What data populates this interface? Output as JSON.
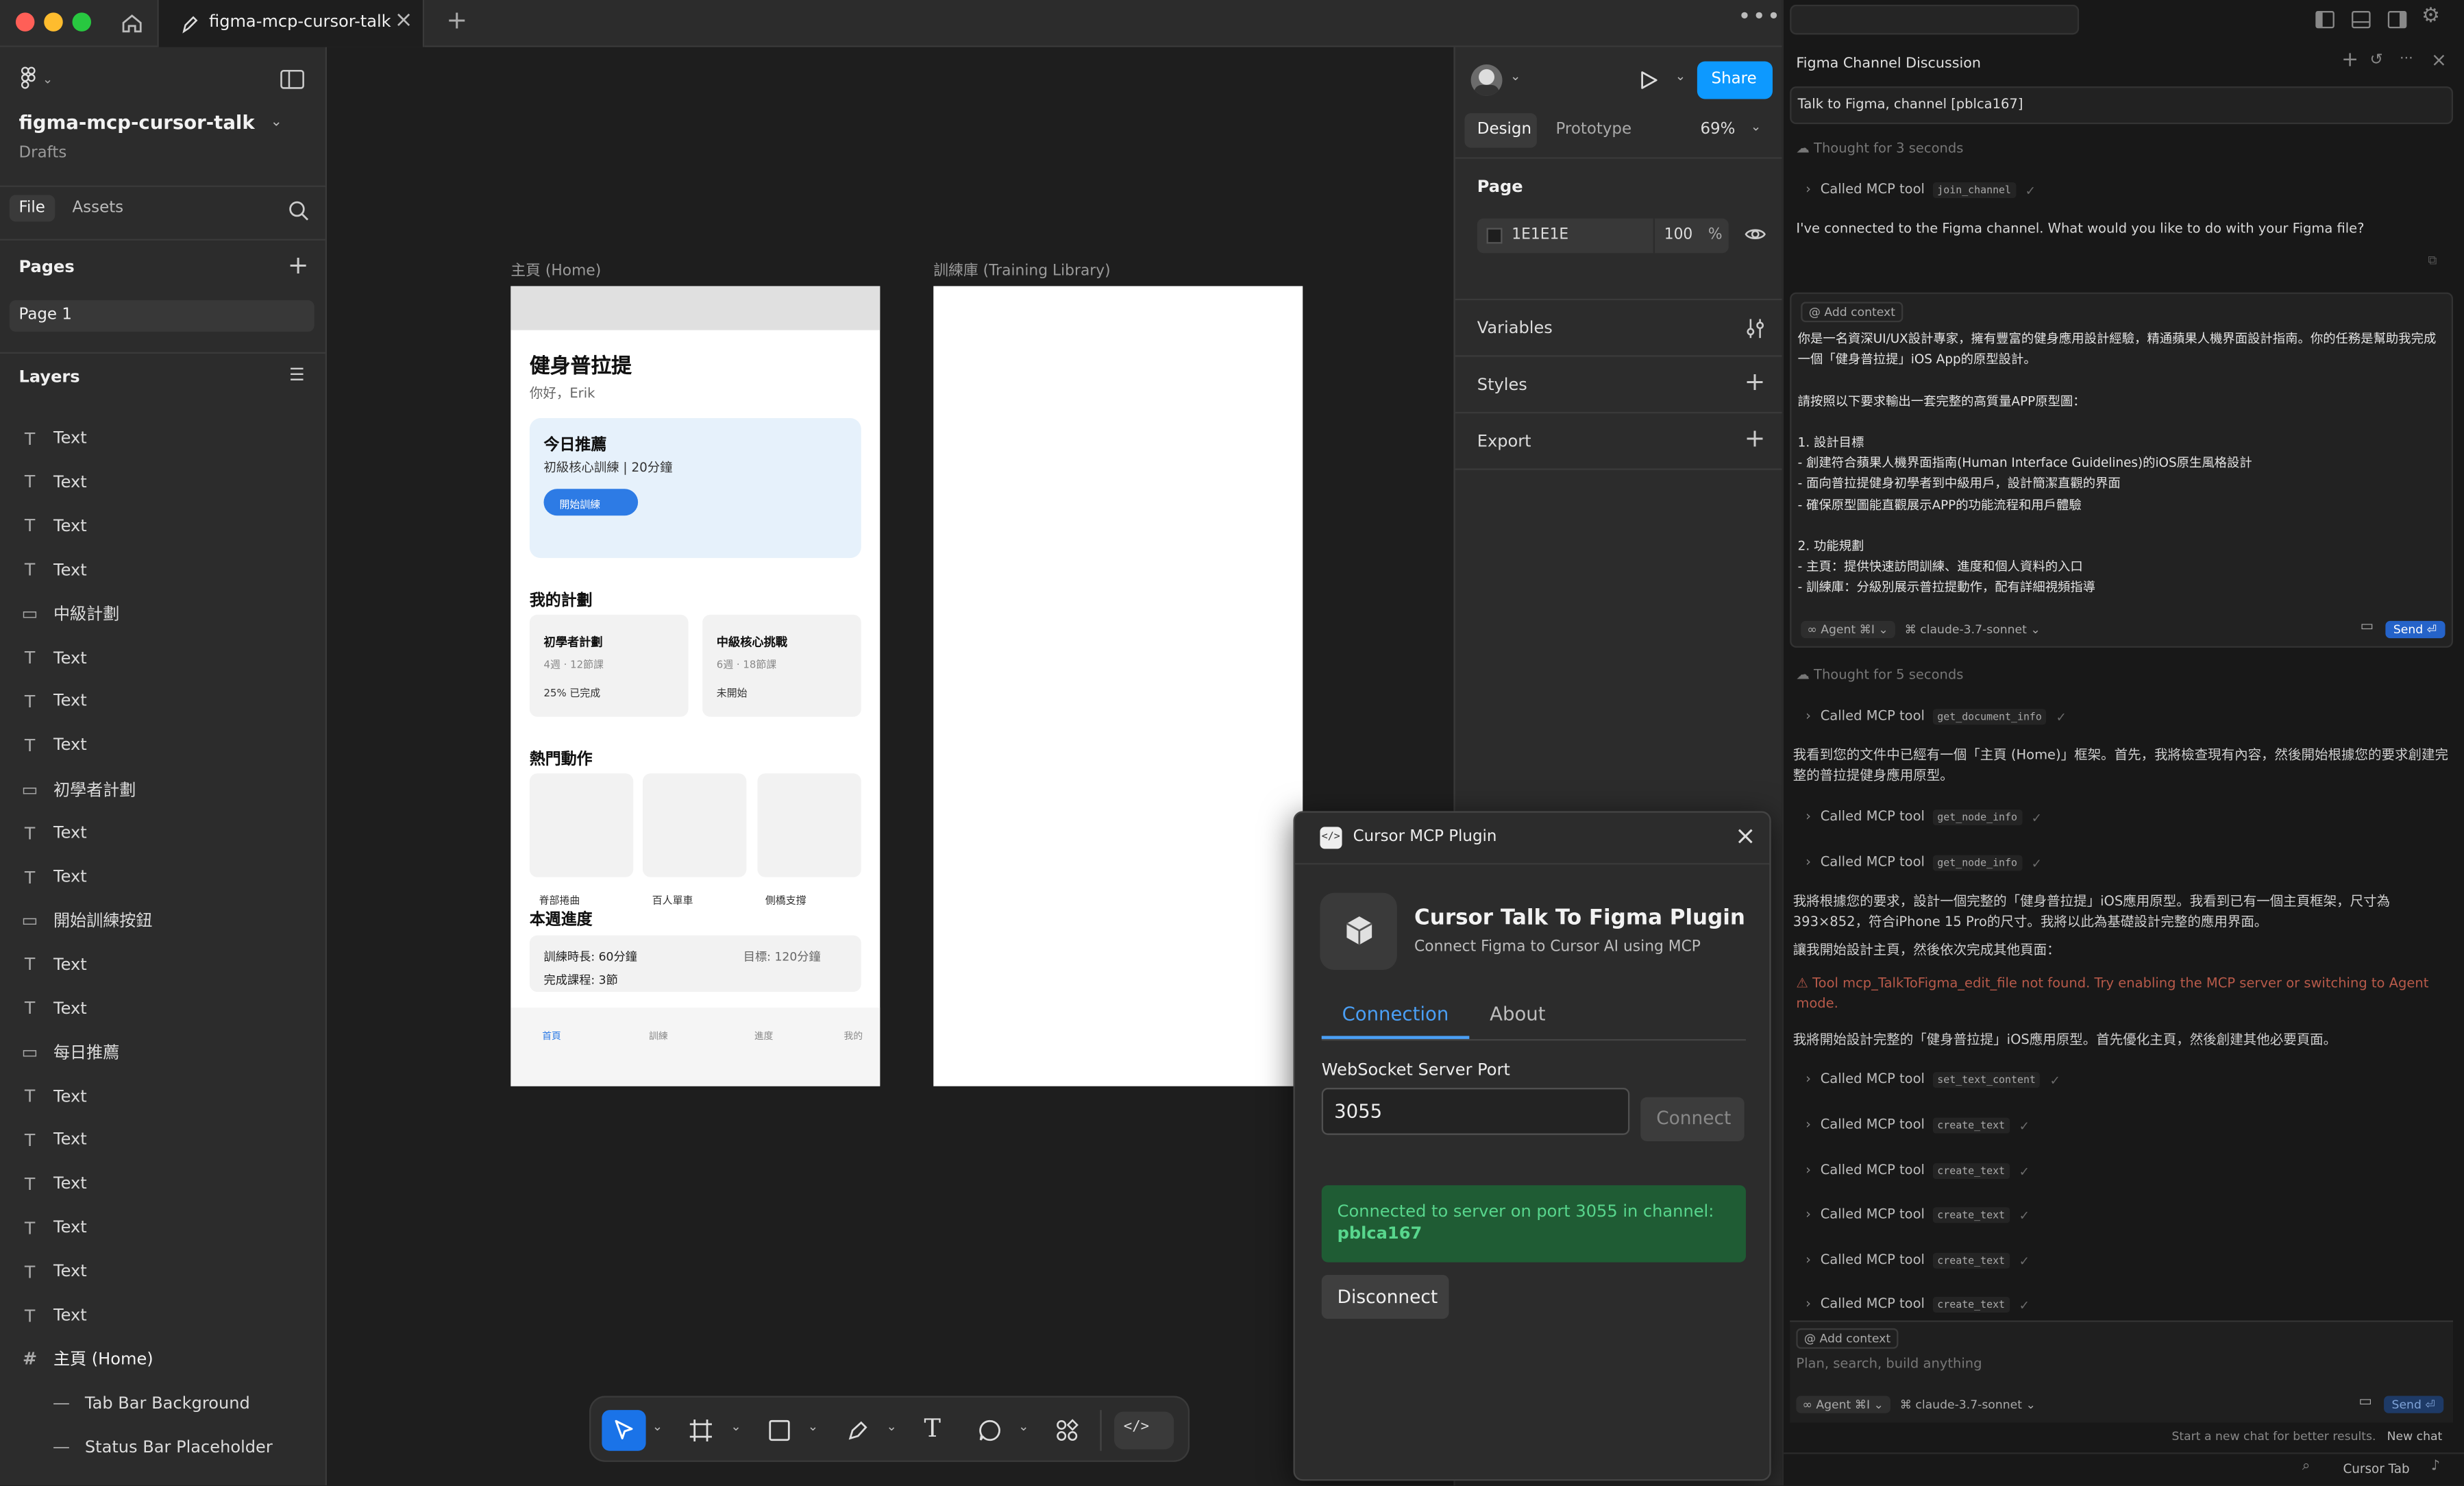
{
  "window": {
    "tab_title": "figma-mcp-cursor-talk",
    "colors": {
      "close": "#ff5f57",
      "minimize": "#febc2e",
      "maximize": "#28c840"
    }
  },
  "left_panel": {
    "file_name": "figma-mcp-cursor-talk",
    "location": "Drafts",
    "tabs": [
      "File",
      "Assets"
    ],
    "pages_title": "Pages",
    "pages": [
      "Page 1"
    ],
    "layers_title": "Layers",
    "layers": [
      {
        "type": "text",
        "name": "Text"
      },
      {
        "type": "text",
        "name": "Text"
      },
      {
        "type": "text",
        "name": "Text"
      },
      {
        "type": "text",
        "name": "Text"
      },
      {
        "type": "rect",
        "name": "中級計劃"
      },
      {
        "type": "text",
        "name": "Text"
      },
      {
        "type": "text",
        "name": "Text"
      },
      {
        "type": "text",
        "name": "Text"
      },
      {
        "type": "rect",
        "name": "初學者計劃"
      },
      {
        "type": "text",
        "name": "Text"
      },
      {
        "type": "text",
        "name": "Text"
      },
      {
        "type": "rect",
        "name": "開始訓練按鈕"
      },
      {
        "type": "text",
        "name": "Text"
      },
      {
        "type": "text",
        "name": "Text"
      },
      {
        "type": "rect",
        "name": "每日推薦"
      },
      {
        "type": "text",
        "name": "Text"
      },
      {
        "type": "text",
        "name": "Text"
      },
      {
        "type": "text",
        "name": "Text"
      },
      {
        "type": "text",
        "name": "Text"
      },
      {
        "type": "text",
        "name": "Text"
      },
      {
        "type": "text",
        "name": "Text"
      },
      {
        "type": "frame",
        "name": "主頁 (Home)"
      },
      {
        "type": "line",
        "name": "Tab Bar Background"
      },
      {
        "type": "line",
        "name": "Status Bar Placeholder"
      }
    ]
  },
  "canvas": {
    "frame_home_label": "主頁 (Home)",
    "frame_library_label": "訓練庫 (Training Library)",
    "home": {
      "title": "健身普拉提",
      "greeting": "你好，Erik",
      "today_title": "今日推薦",
      "today_sub": "初級核心訓練 | 20分鐘",
      "start_btn": "開始訓練",
      "my_plans": "我的計劃",
      "plan1_title": "初學者計劃",
      "plan1_sub": "4週 · 12節課",
      "plan1_status": "25% 已完成",
      "plan2_title": "中級核心挑戰",
      "plan2_sub": "6週 · 18節課",
      "plan2_status": "未開始",
      "popular": "熱門動作",
      "move1": "脊部捲曲",
      "move2": "百人單車",
      "move3": "側橋支撐",
      "weekly": "本週進度",
      "duration": "訓練時長: 60分鐘",
      "goal": "目標: 120分鐘",
      "courses": "完成課程: 3節",
      "tabs": [
        "首頁",
        "訓練",
        "進度",
        "我的"
      ]
    }
  },
  "design_panel": {
    "tabs": [
      "Design",
      "Prototype"
    ],
    "zoom": "69%",
    "share": "Share",
    "page_section": "Page",
    "bg_hex": "1E1E1E",
    "bg_opacity": "100",
    "percent": "%",
    "sections": [
      "Variables",
      "Styles",
      "Export"
    ]
  },
  "plugin": {
    "title": "Cursor MCP Plugin",
    "heading": "Cursor Talk To Figma Plugin",
    "subheading": "Connect Figma to Cursor AI using MCP",
    "tabs": [
      "Connection",
      "About"
    ],
    "port_label": "WebSocket Server Port",
    "port_value": "3055",
    "connect_btn": "Connect",
    "status_text": "Connected to server on port 3055 in channel:",
    "channel": "pblca167",
    "disconnect_btn": "Disconnect",
    "accent": "#4a9ff5",
    "status_bg": "#1f5c34"
  },
  "chat": {
    "title": "Figma Channel Discussion",
    "first_prompt": "Talk to Figma, channel [pblca167]",
    "thought1": "Thought for 3 seconds",
    "called": "Called MCP tool",
    "tool_join": "join_channel",
    "reply1": "I've connected to the Figma channel. What would you like to do with your Figma file?",
    "add_context": "Add context",
    "user_prompt": [
      "你是一名資深UI/UX設計專家，擁有豐富的健身應用設計經驗，精通蘋果人機界面設計指南。你的任務是幫助我完成一個「健身普拉提」iOS App的原型設計。",
      "",
      "請按照以下要求輸出一套完整的高質量APP原型圖：",
      "",
      "1. 設計目標",
      "- 創建符合蘋果人機界面指南(Human Interface Guidelines)的iOS原生風格設計",
      "- 面向普拉提健身初學者到中級用戶，設計簡潔直觀的界面",
      "- 確保原型圖能直觀展示APP的功能流程和用戶體驗",
      "",
      "2. 功能規劃",
      "- 主頁：提供快速訪問訓練、進度和個人資料的入口",
      "- 訓練庫：分級別展示普拉提動作，配有詳細視頻指導"
    ],
    "agent": "Agent",
    "agent_key": "⌘I",
    "model": "claude-3.7-sonnet",
    "send": "Send",
    "thought2": "Thought for 5 seconds",
    "tool_get_doc": "get_document_info",
    "reply2": "我看到您的文件中已經有一個「主頁 (Home)」框架。首先，我將檢查現有內容，然後開始根據您的要求創建完整的普拉提健身應用原型。",
    "tool_get_node": "get_node_info",
    "reply3": "我將根據您的要求，設計一個完整的「健身普拉提」iOS應用原型。我看到已有一個主頁框架，尺寸為393×852，符合iPhone 15 Pro的尺寸。我將以此為基礎設計完整的應用界面。",
    "reply3b": "讓我開始設計主頁，然後依次完成其他頁面：",
    "error": "Tool mcp_TalkToFigma_edit_file not found. Try enabling the MCP server or switching to Agent mode.",
    "reply4": "我將開始設計完整的「健身普拉提」iOS應用原型。首先優化主頁，然後創建其他必要頁面。",
    "tool_set_text": "set_text_content",
    "tool_create_text": "create_text",
    "input_placeholder": "Plan, search, build anything",
    "footer_hint": "Start a new chat for better results.",
    "new_chat": "New chat",
    "cursor_tab": "Cursor Tab",
    "error_color": "#b85a4a"
  }
}
